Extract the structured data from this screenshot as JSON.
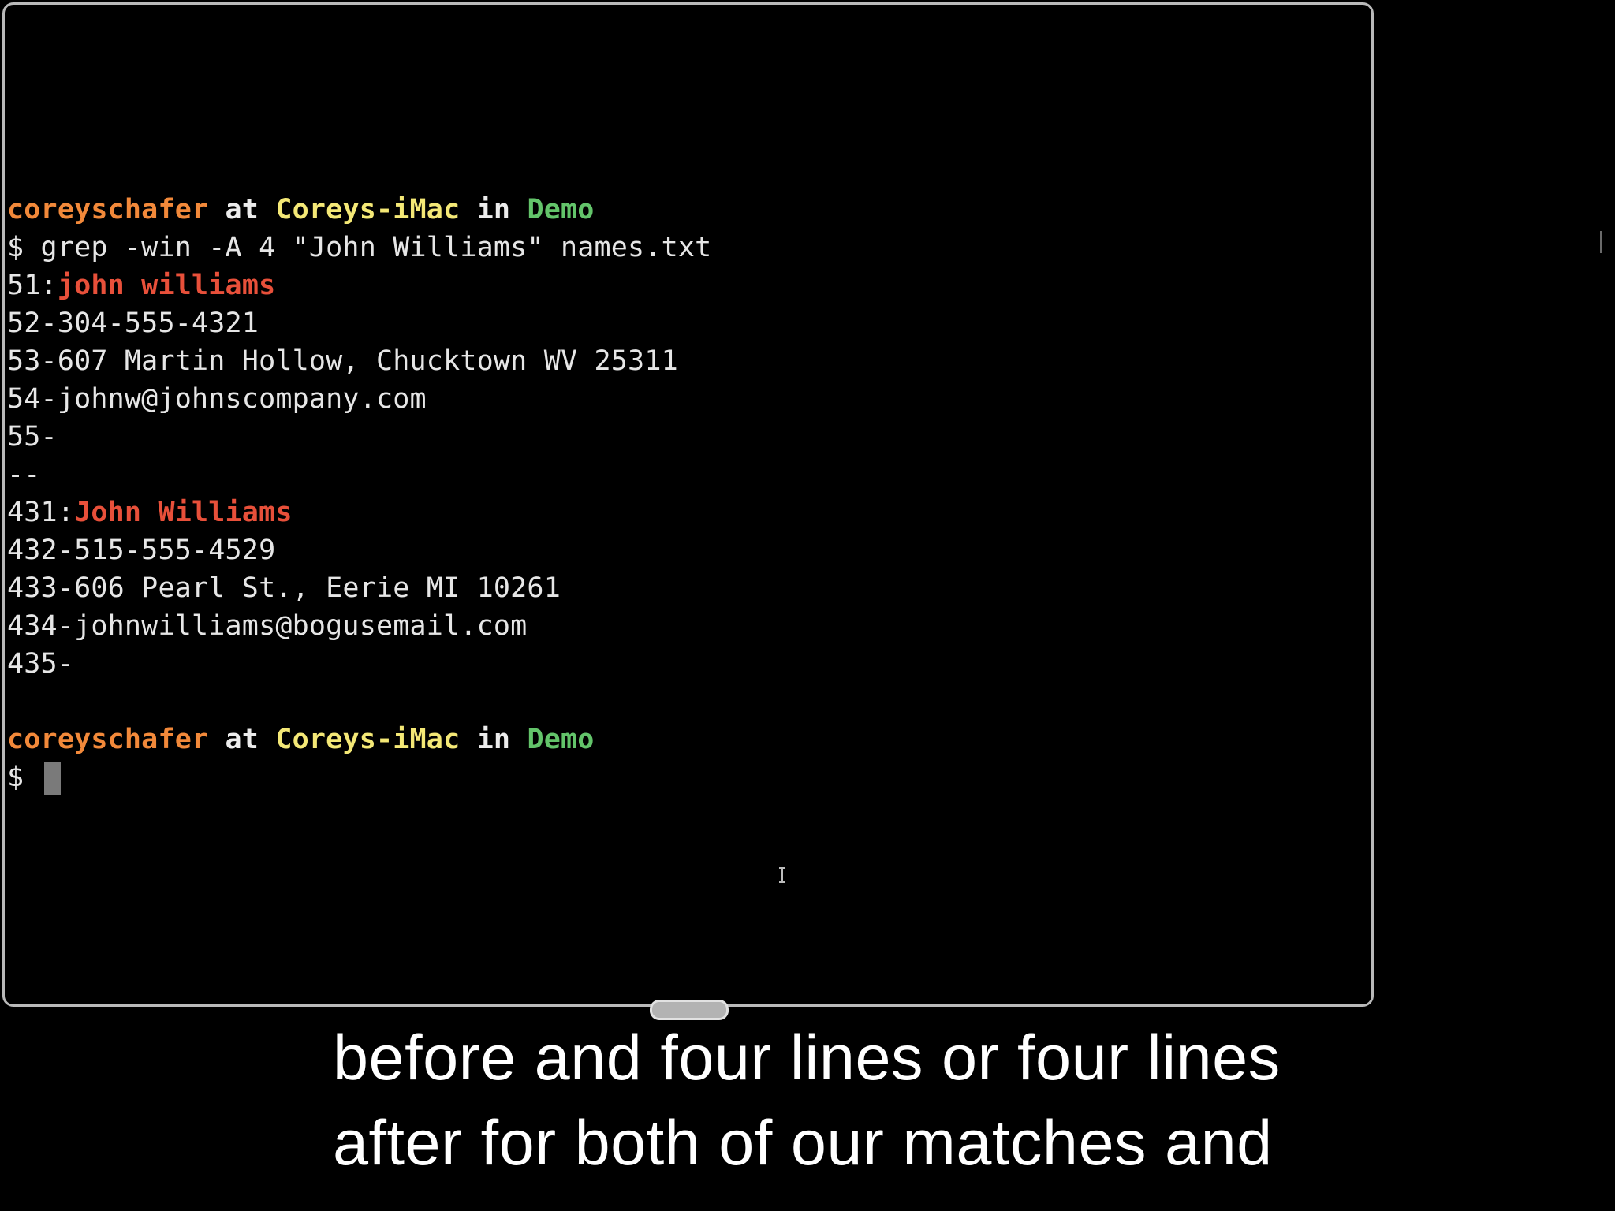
{
  "terminal": {
    "prompt1": {
      "user": "coreyschafer",
      "at": " at ",
      "host": "Coreys-iMac",
      "in": " in ",
      "dir": "Demo"
    },
    "command_line": "$ grep -win -A 4 \"John Williams\" names.txt",
    "result1": {
      "prefix": "51:",
      "match": "john williams",
      "context": [
        "52-304-555-4321",
        "53-607 Martin Hollow, Chucktown WV 25311",
        "54-johnw@johnscompany.com",
        "55-"
      ]
    },
    "separator": "--",
    "result2": {
      "prefix": "431:",
      "match": "John Williams",
      "context": [
        "432-515-555-4529",
        "433-606 Pearl St., Eerie MI 10261",
        "434-johnwilliams@bogusemail.com",
        "435-"
      ]
    },
    "prompt2": {
      "user": "coreyschafer",
      "at": " at ",
      "host": "Coreys-iMac",
      "in": " in ",
      "dir": "Demo"
    },
    "input_prompt": "$ "
  },
  "caption": {
    "line1": "before and four lines or four lines",
    "line2": "after for both of our matches and"
  },
  "colors": {
    "user": "#f2893a",
    "host": "#f4e876",
    "dir": "#63c46a",
    "match": "#e8503a",
    "text": "#e6e6e6",
    "background": "#000000"
  }
}
